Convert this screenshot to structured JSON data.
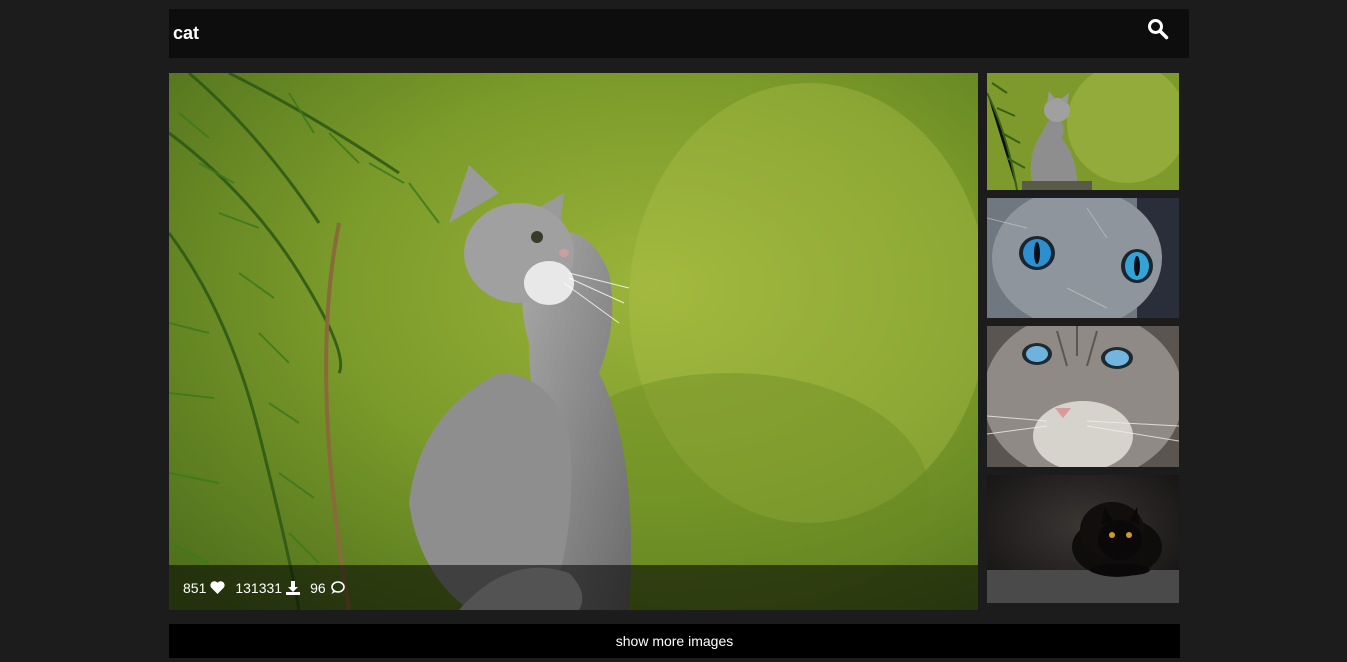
{
  "search": {
    "value": "cat",
    "icon": "search-icon"
  },
  "featured_image": {
    "subject": "grey kitten looking up beside pine branches",
    "stats": {
      "likes": "851",
      "downloads": "131331",
      "comments": "96"
    },
    "icons": [
      "heart-icon",
      "download-icon",
      "comment-icon"
    ]
  },
  "thumbnails": [
    {
      "subject": "grey kitten sitting by pine branches"
    },
    {
      "subject": "close-up of cat blue eyes"
    },
    {
      "subject": "tabby cat face with blue eyes"
    },
    {
      "subject": "black cat lying down on dark background"
    }
  ],
  "more_button": {
    "label": "show more images"
  },
  "colors": {
    "page_background": "#1c1c1c",
    "bar_background": "#0d0d0d",
    "button_background": "#000000",
    "text": "#ffffff"
  }
}
